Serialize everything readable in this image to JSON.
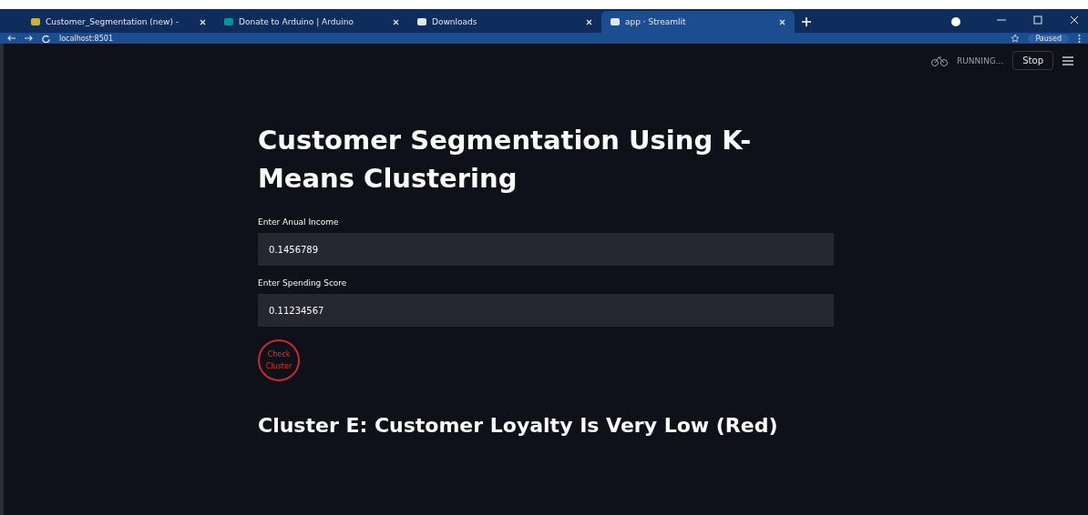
{
  "browser": {
    "tabs": [
      {
        "title": "Customer_Segmentation (new) -",
        "selected": false
      },
      {
        "title": "Donate to Arduino | Arduino",
        "selected": false
      },
      {
        "title": "Downloads",
        "selected": false
      },
      {
        "title": "app · Streamlit",
        "selected": true
      }
    ],
    "address": "localhost:8501",
    "profile_status": "Paused"
  },
  "header": {
    "status": "RUNNING...",
    "stop_button": "Stop"
  },
  "title": "Customer Segmentation Using K-Means Clustering",
  "fields": [
    {
      "label": "Enter Anual Income",
      "value": "0.1456789"
    },
    {
      "label": "Enter Spending Score",
      "value": "0.11234567"
    }
  ],
  "submit_button": "Check Cluster",
  "result": "Cluster E: Customer Loyalty Is Very Low (Red)"
}
